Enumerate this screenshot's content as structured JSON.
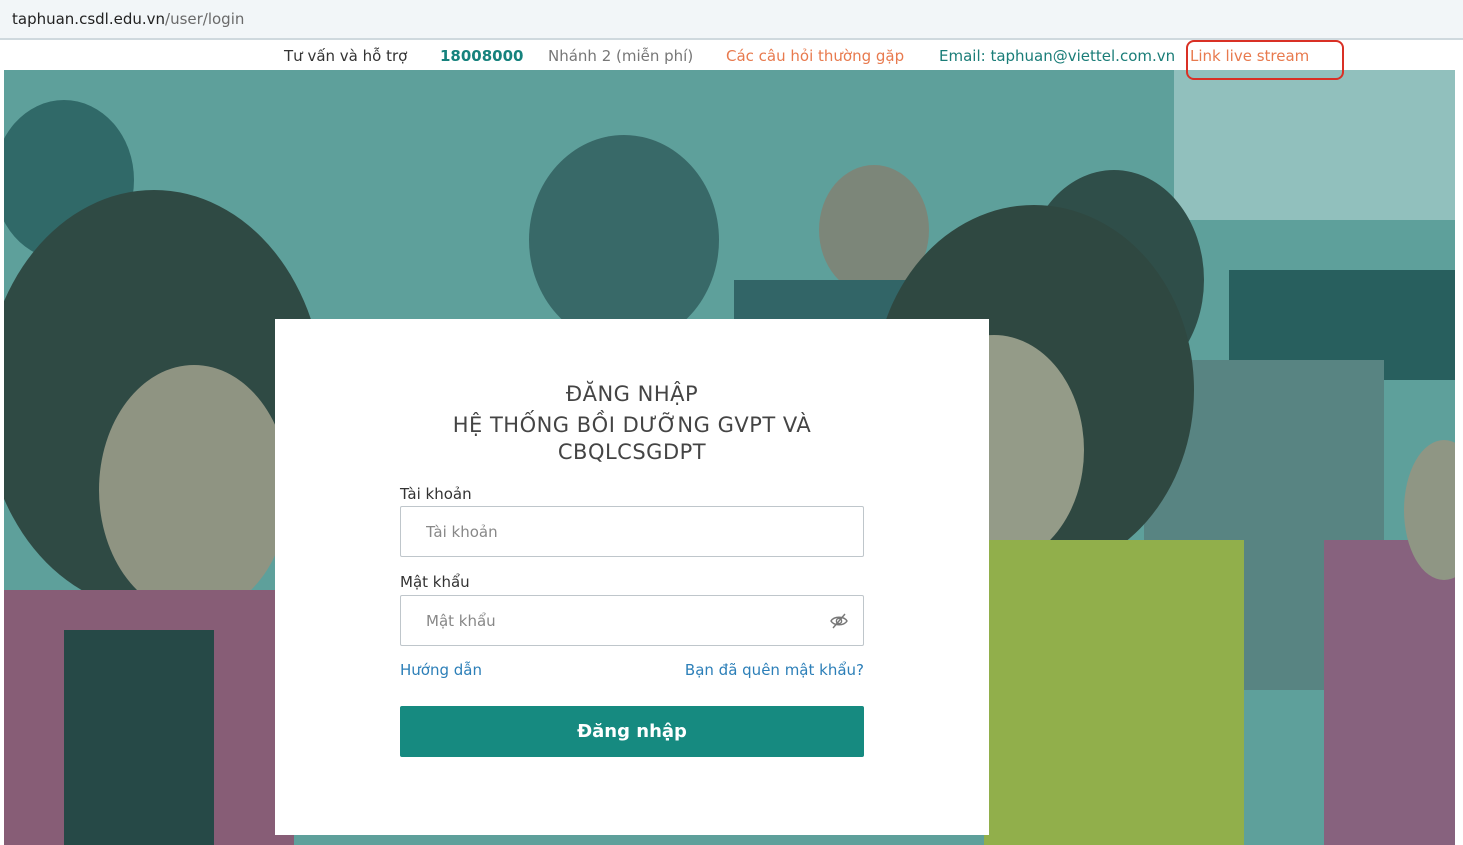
{
  "browser": {
    "url_host": "taphuan.csdl.edu.vn",
    "url_path": "/user/login"
  },
  "top_bar": {
    "support_label": "Tư vấn và hỗ trợ",
    "phone": "18008000",
    "branch": "Nhánh 2 (miễn phí)",
    "faq_link": "Các câu hỏi thường gặp",
    "email": "Email: taphuan@viettel.com.vn",
    "live_stream_link": "Link live stream"
  },
  "login": {
    "title": "ĐĂNG NHẬP",
    "subtitle": "HỆ THỐNG BỒI DƯỠNG GVPT VÀ CBQLCSGDPT",
    "username_label": "Tài khoản",
    "username_placeholder": "Tài khoản",
    "password_label": "Mật khẩu",
    "password_placeholder": "Mật khẩu",
    "guide_link": "Hướng dẫn",
    "forgot_link": "Bạn đã quên mật khẩu?",
    "submit_label": "Đăng nhập"
  },
  "colors": {
    "accent": "#168a80",
    "highlight_border": "#d93025",
    "faq_link": "#e87a4e",
    "link_blue": "#2c7fb8"
  },
  "icons": {
    "password_toggle": "eye-slash-icon"
  }
}
